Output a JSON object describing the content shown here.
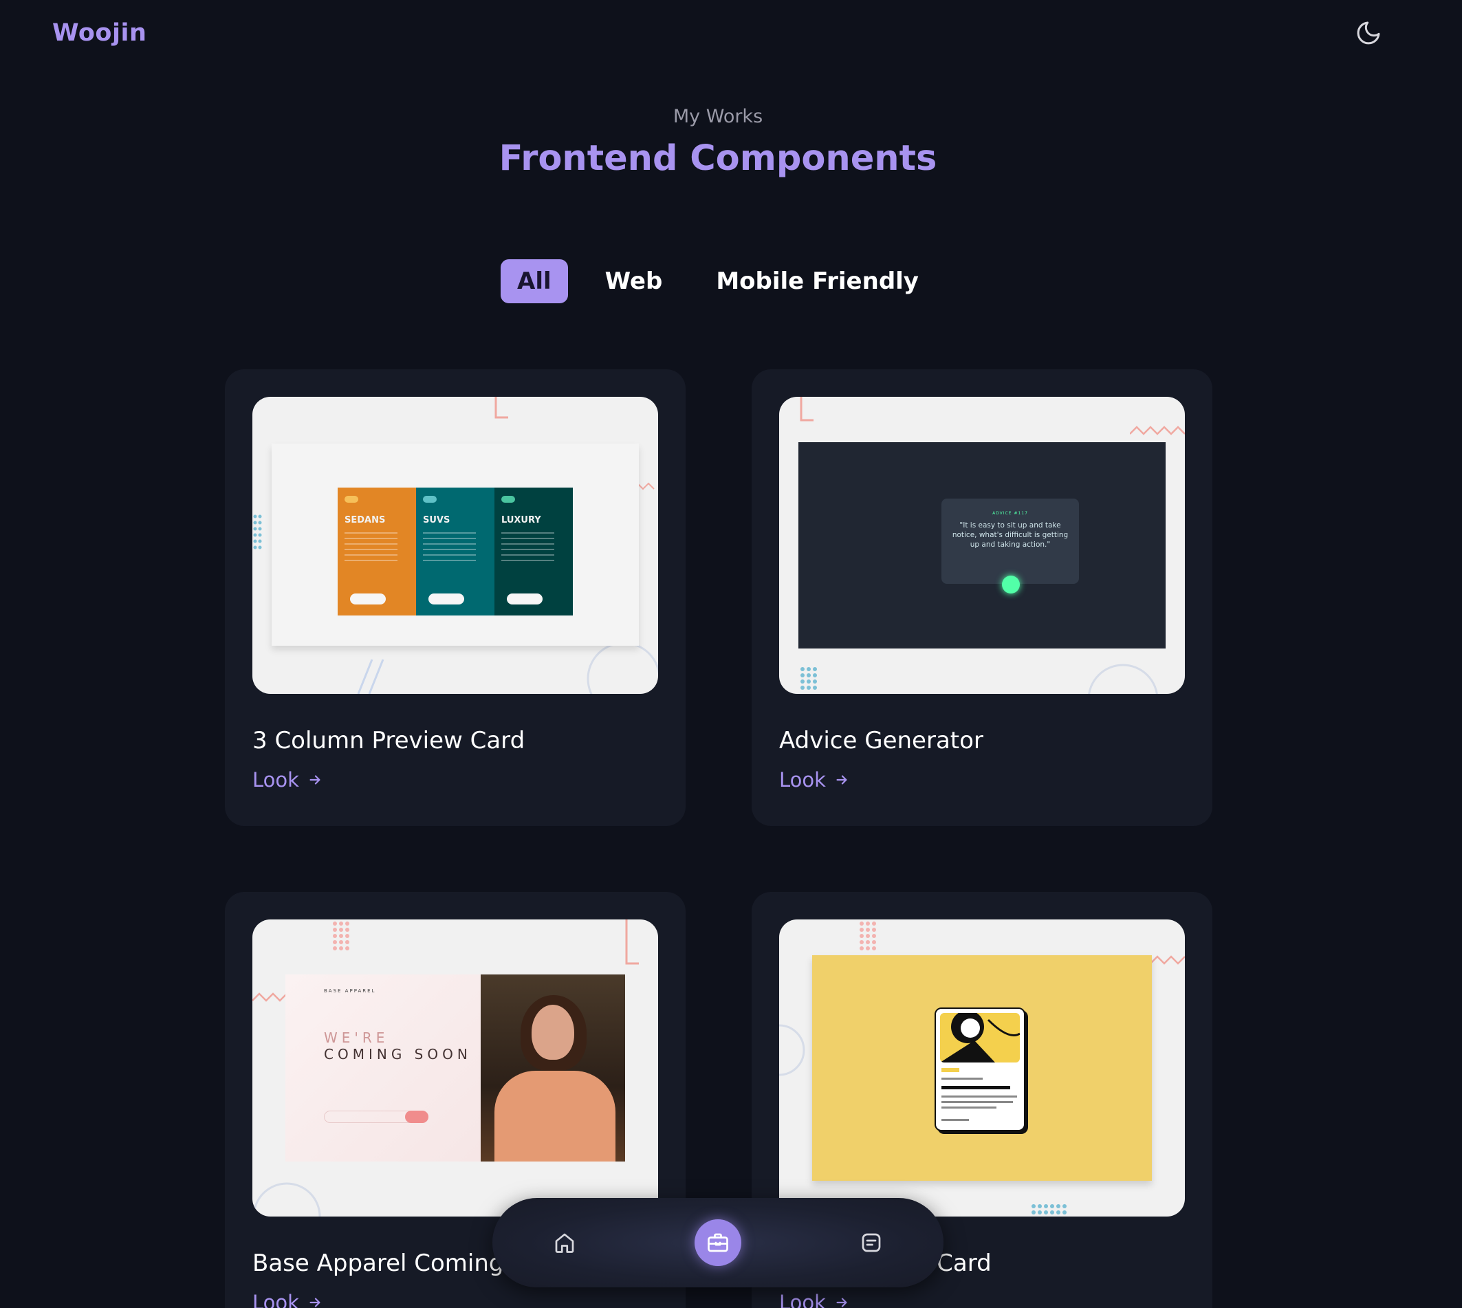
{
  "header": {
    "logo": "Woojin",
    "theme_icon": "moon-icon"
  },
  "section": {
    "subtitle": "My Works",
    "title": "Frontend Components"
  },
  "filters": [
    {
      "label": "All",
      "active": true
    },
    {
      "label": "Web",
      "active": false
    },
    {
      "label": "Mobile Friendly",
      "active": false
    }
  ],
  "projects": [
    {
      "title": "3 Column Preview Card",
      "link": "Look"
    },
    {
      "title": "Advice Generator",
      "link": "Look"
    },
    {
      "title": "Base Apparel Coming Soon",
      "link": "Look"
    },
    {
      "title": "Blog Preview Card",
      "link": "Look"
    }
  ],
  "previews": {
    "columns": [
      "SEDANS",
      "SUVS",
      "LUXURY"
    ],
    "advice_label": "ADVICE #117",
    "advice_quote": "\"It is easy to sit up and take notice, what's difficult is getting up and taking action.\"",
    "apparel_brand": "BASE APPAREL",
    "apparel_heading_light": "WE'RE",
    "apparel_heading_bold": "COMING SOON",
    "blog_tag": "Learning",
    "blog_title": "HTML & CSS foundations"
  },
  "bottom_nav": [
    {
      "name": "home",
      "icon": "home-icon",
      "active": false
    },
    {
      "name": "works",
      "icon": "briefcase-icon",
      "active": true
    },
    {
      "name": "blog",
      "icon": "message-icon",
      "active": false
    }
  ],
  "colors": {
    "background": "#0e111b",
    "card": "#161a26",
    "accent": "#a893f0"
  }
}
